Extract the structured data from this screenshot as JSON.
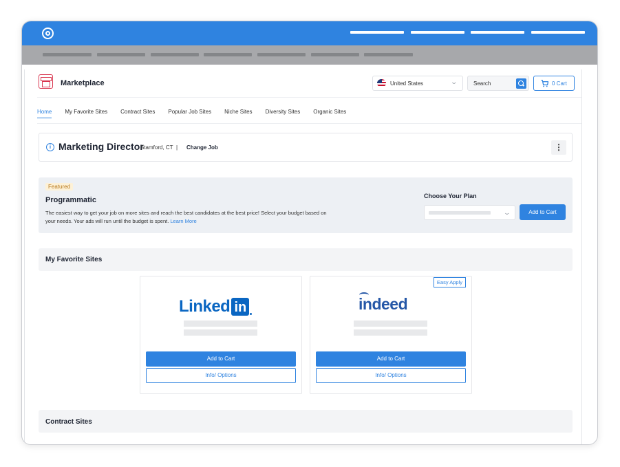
{
  "header": {
    "app_title": "Marketplace",
    "country": "United States",
    "search_placeholder": "Search",
    "cart_label": "0 Cart"
  },
  "tabs": [
    {
      "label": "Home",
      "active": true
    },
    {
      "label": "My Favorite Sites",
      "active": false
    },
    {
      "label": "Contract Sites",
      "active": false
    },
    {
      "label": "Popular Job Sites",
      "active": false
    },
    {
      "label": "Niche Sites",
      "active": false
    },
    {
      "label": "Diversity Sites",
      "active": false
    },
    {
      "label": "Organic Sites",
      "active": false
    }
  ],
  "job": {
    "title": "Marketing Director",
    "location": "Stamford, CT",
    "separator": "|",
    "change_label": "Change Job",
    "info_glyph": "i",
    "menu_glyph": "⋮"
  },
  "featured": {
    "badge": "Featured",
    "title": "Programmatic",
    "description": "The easiest way to get your job on more sites and reach the best candidates at the best price! Select your budget based on your needs. Your ads will run until the budget is spent.",
    "learn_more": "Learn More",
    "plan_label": "Choose Your Plan",
    "add_label": "Add to Cart"
  },
  "favorites": {
    "title": "My Favorite Sites",
    "cards": [
      {
        "logo_text": "Linked",
        "logo_box": "in",
        "badge": "",
        "add_label": "Add to Cart",
        "info_label": "Info/ Options"
      },
      {
        "logo_text": "indeed",
        "logo_box": "",
        "badge": "Easy Apply",
        "add_label": "Add to Cart",
        "info_label": "Info/ Options"
      }
    ]
  },
  "contract": {
    "title": "Contract Sites"
  },
  "colors": {
    "accent": "#2f83e0",
    "linkedin": "#0a66c2",
    "indeed": "#2557a7",
    "featured_badge_bg": "#fdf1d7"
  },
  "icons": [
    "app-logo-icon",
    "store-icon",
    "us-flag-icon",
    "chevron-down-icon",
    "search-icon",
    "cart-icon",
    "info-icon",
    "kebab-menu-icon"
  ]
}
